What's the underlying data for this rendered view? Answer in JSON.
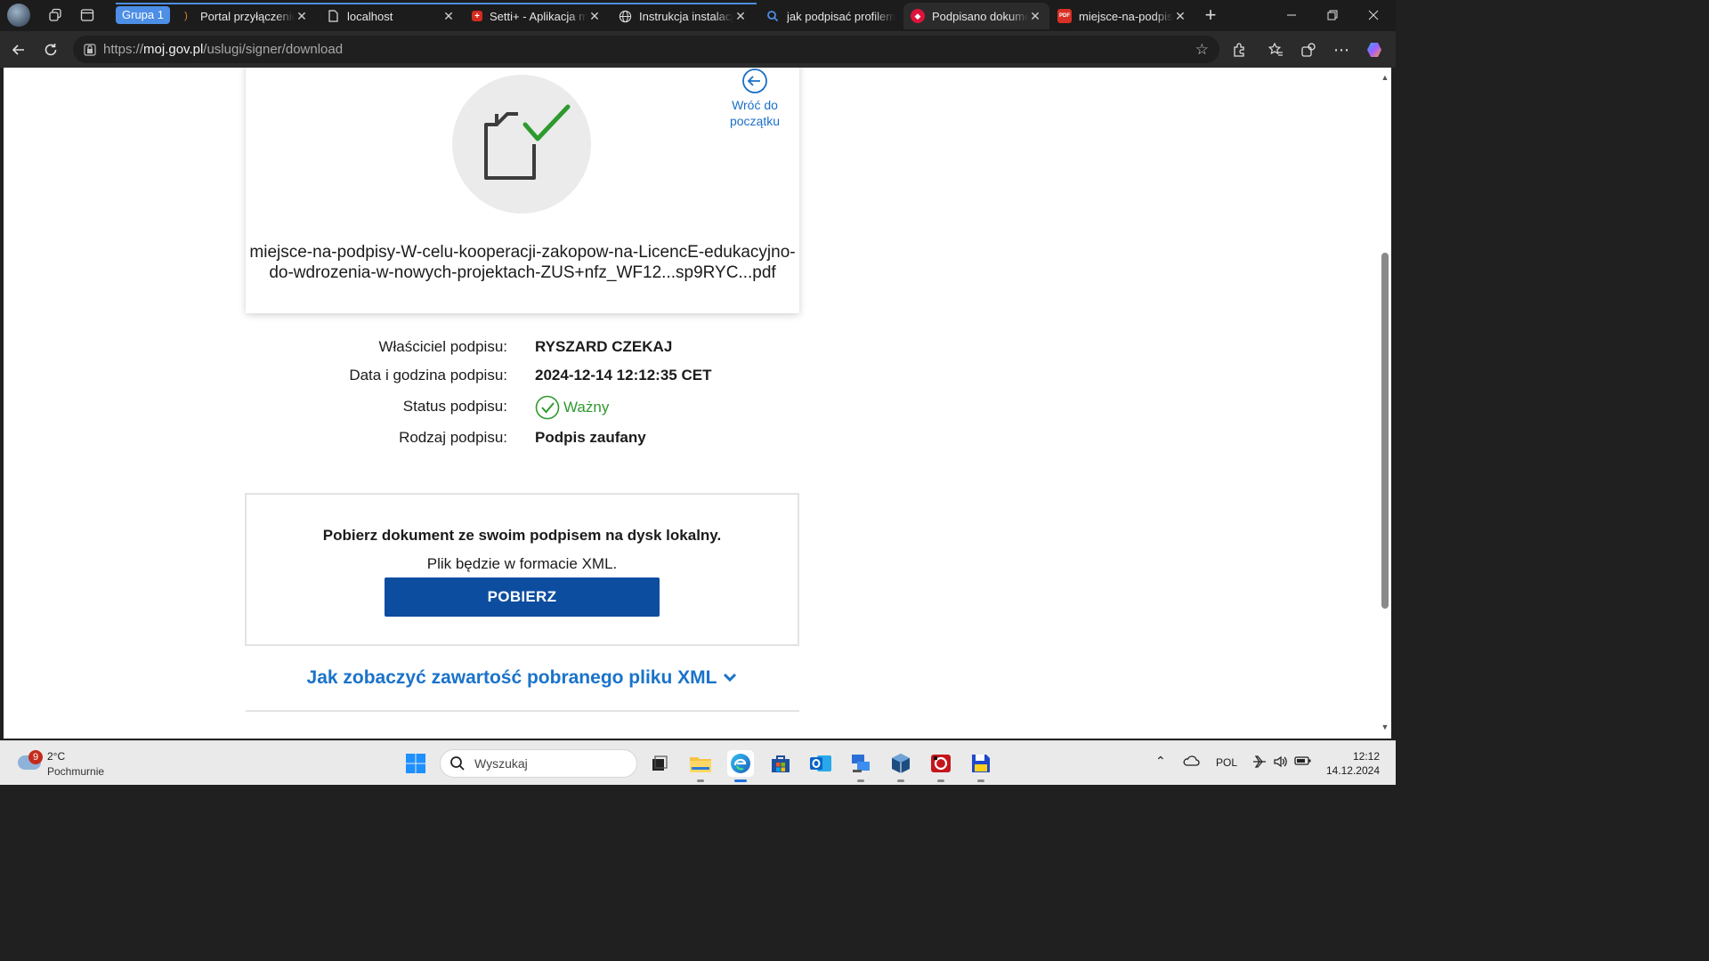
{
  "browser": {
    "group_label": "Grupa 1",
    "tabs": [
      {
        "title": "Portal przyłączeniowy",
        "active": false
      },
      {
        "title": "localhost",
        "active": false
      },
      {
        "title": "Setti+ - Aplikacja mobilna",
        "active": false
      },
      {
        "title": "Instrukcja instalacji",
        "active": false
      },
      {
        "title": "jak podpisać profilem zaufanym",
        "active": false
      },
      {
        "title": "Podpisano dokument",
        "active": true
      },
      {
        "title": "miejsce-na-podpisy",
        "active": false
      }
    ],
    "new_tab_symbol": "+",
    "url_prefix": "https://",
    "url_host": "moj.gov.pl",
    "url_path": "/uslugi/signer/download"
  },
  "page": {
    "back_label_line1": "Wróć do",
    "back_label_line2": "początku",
    "file_name": "miejsce-na-podpisy-W-celu-kooperacji-zakopow-na-LicencE-edukacyjno-do-wdrozenia-w-nowych-projektach-ZUS+nfz_WF12...sp9RYC...pdf",
    "details": {
      "owner_label": "Właściciel podpisu:",
      "owner_value": "RYSZARD CZEKAJ",
      "date_label": "Data i godzina podpisu:",
      "date_value": "2024-12-14 12:12:35 CET",
      "status_label": "Status podpisu:",
      "status_value": "Ważny",
      "type_label": "Rodzaj podpisu:",
      "type_value": "Podpis zaufany"
    },
    "download": {
      "title": "Pobierz dokument ze swoim podpisem na dysk lokalny.",
      "subtitle": "Plik będzie w formacie XML.",
      "button_label": "POBIERZ"
    },
    "xml_help_link": "Jak zobaczyć zawartość pobranego pliku XML"
  },
  "taskbar": {
    "weather_badge": "9",
    "weather_temp": "2°C",
    "weather_condition": "Pochmurnie",
    "search_placeholder": "Wyszukaj",
    "language": "POL",
    "time": "12:12",
    "date": "14.12.2024"
  },
  "colors": {
    "link_blue": "#1a73c9",
    "button_blue": "#0d4d9f",
    "valid_green": "#2e9a2e"
  }
}
